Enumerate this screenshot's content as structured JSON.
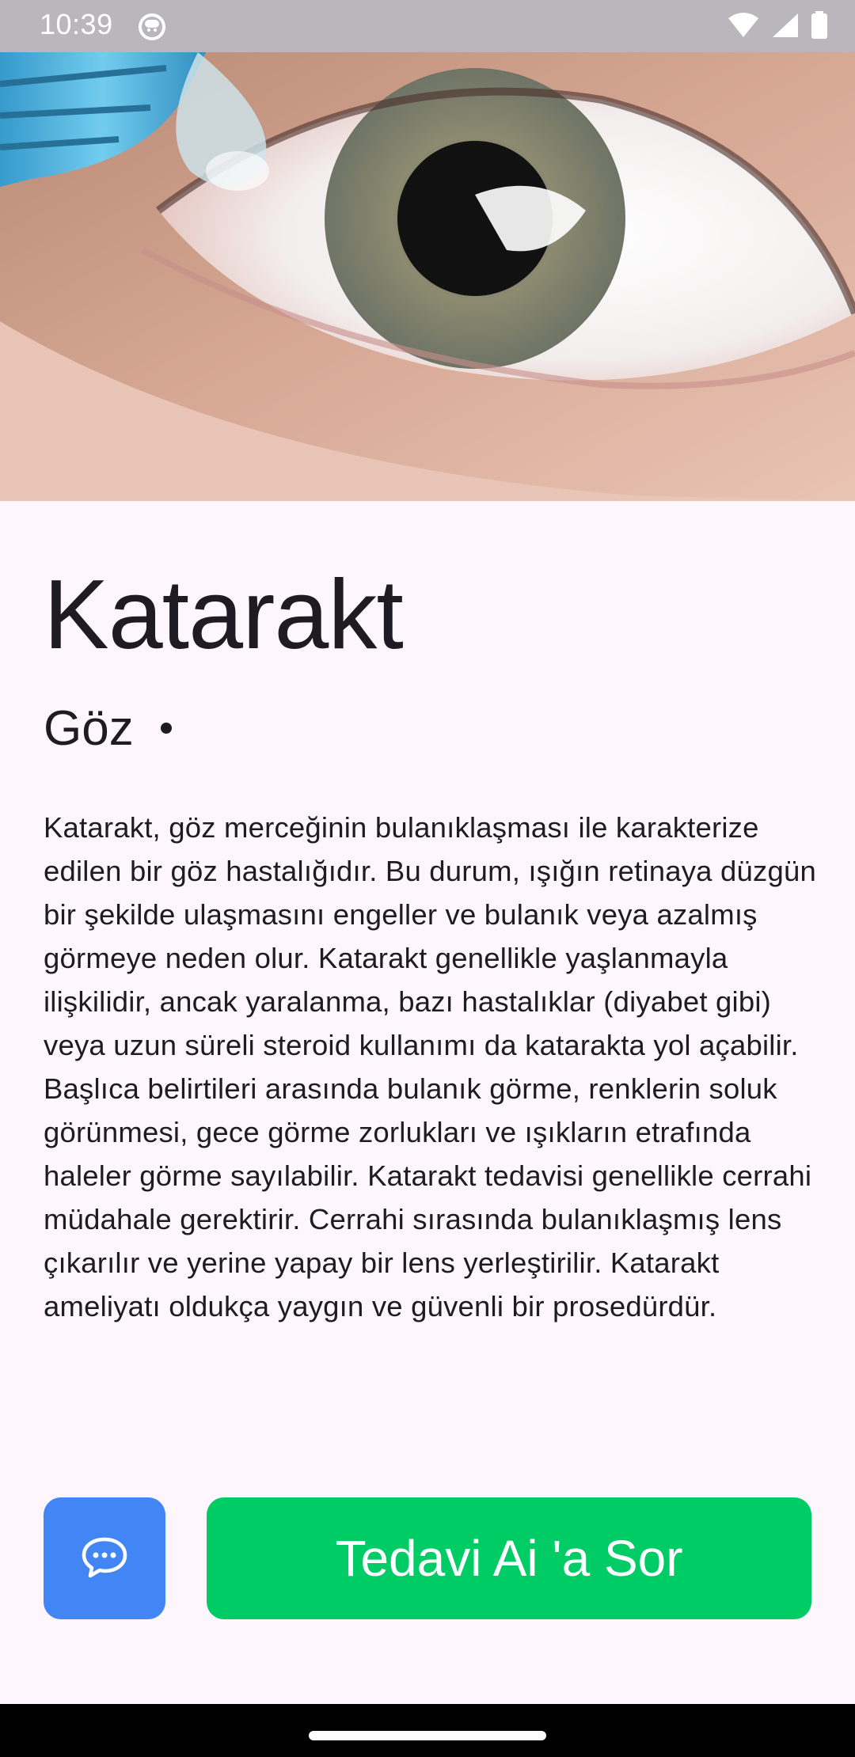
{
  "status_bar": {
    "time": "10:39",
    "app_icon": "android-face-icon",
    "icons": [
      "wifi-icon",
      "signal-icon",
      "battery-icon"
    ]
  },
  "hero": {
    "image": "eye-drop-photo"
  },
  "article": {
    "title": "Katarakt",
    "category": "Göz",
    "description": "Katarakt, göz merceğinin bulanıklaşması ile karakterize edilen bir göz hastalığıdır. Bu durum, ışığın retinaya düzgün bir şekilde ulaşmasını engeller ve bulanık veya azalmış görmeye neden olur. Katarakt genellikle yaşlanmayla ilişkilidir, ancak yaralanma, bazı hastalıklar (diyabet gibi) veya uzun süreli steroid kullanımı da katarakta yol açabilir. Başlıca belirtileri arasında bulanık görme, renklerin soluk görünmesi, gece görme zorlukları ve ışıkların etrafında haleler görme sayılabilir. Katarakt tedavisi genellikle cerrahi müdahale gerektirir. Cerrahi sırasında bulanıklaşmış lens çıkarılır ve yerine yapay bir lens yerleştirilir. Katarakt ameliyatı oldukça yaygın ve güvenli bir prosedürdür."
  },
  "actions": {
    "chat_icon": "chat-bubble-icon",
    "ask_label": "Tedavi Ai 'a Sor"
  },
  "colors": {
    "chat_button": "#4285f4",
    "ask_button": "#00cc66",
    "background": "#fdf6fc"
  }
}
